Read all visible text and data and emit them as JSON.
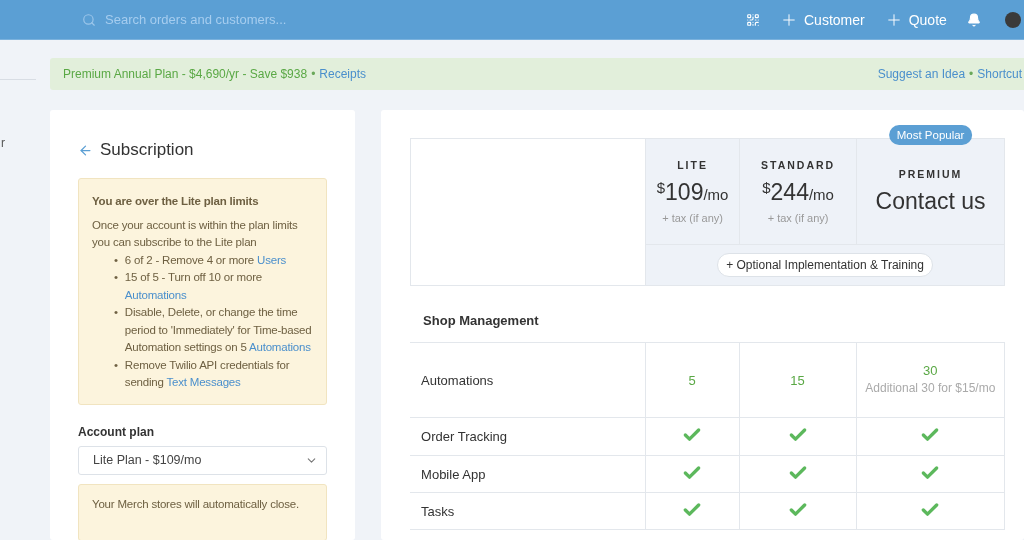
{
  "topbar": {
    "search": {
      "placeholder": "Search orders and customers..."
    },
    "actions": [
      {
        "kind": "qr"
      },
      {
        "kind": "add",
        "label": "Customer"
      },
      {
        "kind": "add",
        "label": "Quote"
      },
      {
        "kind": "bell"
      },
      {
        "kind": "avatar"
      }
    ]
  },
  "sidebar": {
    "items": [
      "r"
    ]
  },
  "banner": {
    "text": "Premium Annual Plan - $4,690/yr - Save $938",
    "separator": "•",
    "link": "Receipts",
    "links": [
      "Suggest an Idea",
      "Shortcut"
    ],
    "links_separator": "•"
  },
  "subscription": {
    "title": "Subscription",
    "alert": {
      "heading": "You are over the Lite plan limits",
      "text": "Once your account is within the plan limits you can subscribe to the Lite plan",
      "bullets": [
        {
          "marker": "•",
          "text": "6 of 2 - Remove 4 or more ",
          "link": "Users"
        },
        {
          "marker": "•",
          "text": "15 of 5 - Turn off 10 or more ",
          "link": "Automations"
        },
        {
          "marker": "•",
          "text": "Disable, Delete, or change the time period to 'Immediately' for Time-based Automation settings on 5 ",
          "link": "Automations"
        },
        {
          "marker": "•",
          "text": "Remove Twilio API credentials for sending ",
          "link": "Text Messages"
        }
      ]
    },
    "plan_label": "Account plan",
    "plan_value": "Lite Plan - $109/mo",
    "notice": "Your Merch stores will automatically close."
  },
  "pricing": {
    "plans": [
      {
        "name": "LITE",
        "currency": "$",
        "price": "109",
        "period": "/mo",
        "note": "+ tax (if any)"
      },
      {
        "name": "STANDARD",
        "currency": "$",
        "price": "244",
        "period": "/mo",
        "note": "+ tax (if any)"
      },
      {
        "name": "PREMIUM",
        "contact": "Contact us",
        "badge": "Most Popular"
      }
    ],
    "optional_button": "+ Optional Implementation & Training",
    "section": "Shop Management",
    "rows": [
      {
        "feature": "Automations",
        "cells": [
          {
            "kind": "value",
            "value": "5"
          },
          {
            "kind": "value",
            "value": "15"
          },
          {
            "kind": "value",
            "value": "30",
            "note": "Additional 30 for $15/mo"
          }
        ]
      },
      {
        "feature": "Order Tracking",
        "cells": [
          {
            "kind": "check",
            "included": true
          },
          {
            "kind": "check",
            "included": true
          },
          {
            "kind": "check",
            "included": true
          }
        ]
      },
      {
        "feature": "Mobile App",
        "cells": [
          {
            "kind": "check",
            "included": true
          },
          {
            "kind": "check",
            "included": true
          },
          {
            "kind": "check",
            "included": true
          }
        ]
      },
      {
        "feature": "Tasks",
        "cells": [
          {
            "kind": "check",
            "included": true
          },
          {
            "kind": "check",
            "included": true
          },
          {
            "kind": "check",
            "included": true
          }
        ]
      }
    ]
  }
}
